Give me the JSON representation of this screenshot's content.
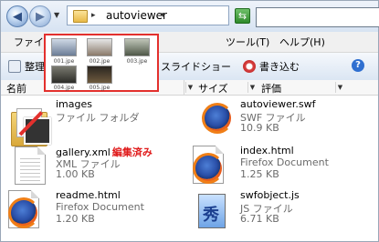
{
  "address": {
    "path_text": "autoviewer",
    "search_placeholder": ""
  },
  "menu": {
    "items": [
      "ファイル",
      "ツール(T)",
      "ヘルプ(H)"
    ]
  },
  "toolbar": {
    "organize_label": "整理",
    "slideshow_label": "スライドショー",
    "burn_label": "書き込む"
  },
  "columns": {
    "name": "名前",
    "size": "サイズ",
    "rating": "評価"
  },
  "thumbnails": {
    "captions": [
      "001.jpe",
      "002.jpe",
      "003.jpe",
      "004.jpe",
      "005.jpe"
    ]
  },
  "files": [
    {
      "name": "images",
      "type": "ファイル フォルダ",
      "size": "",
      "icon": "folder-icon"
    },
    {
      "name": "autoviewer.swf",
      "type": "SWF ファイル",
      "size": "10.9 KB",
      "icon": "firefox-icon"
    },
    {
      "name": "gallery.xml",
      "type": "XML ファイル",
      "size": "1.00 KB",
      "icon": "document-icon",
      "note": "編集済み"
    },
    {
      "name": "index.html",
      "type": "Firefox Document",
      "size": "1.25 KB",
      "icon": "firefox-icon"
    },
    {
      "name": "readme.html",
      "type": "Firefox Document",
      "size": "1.20 KB",
      "icon": "firefox-icon"
    },
    {
      "name": "swfobject.js",
      "type": "JS ファイル",
      "size": "6.71 KB",
      "icon": "js-icon"
    }
  ],
  "colors": {
    "annotation_red": "#e01b1b",
    "accent_blue": "#2f4f84"
  }
}
